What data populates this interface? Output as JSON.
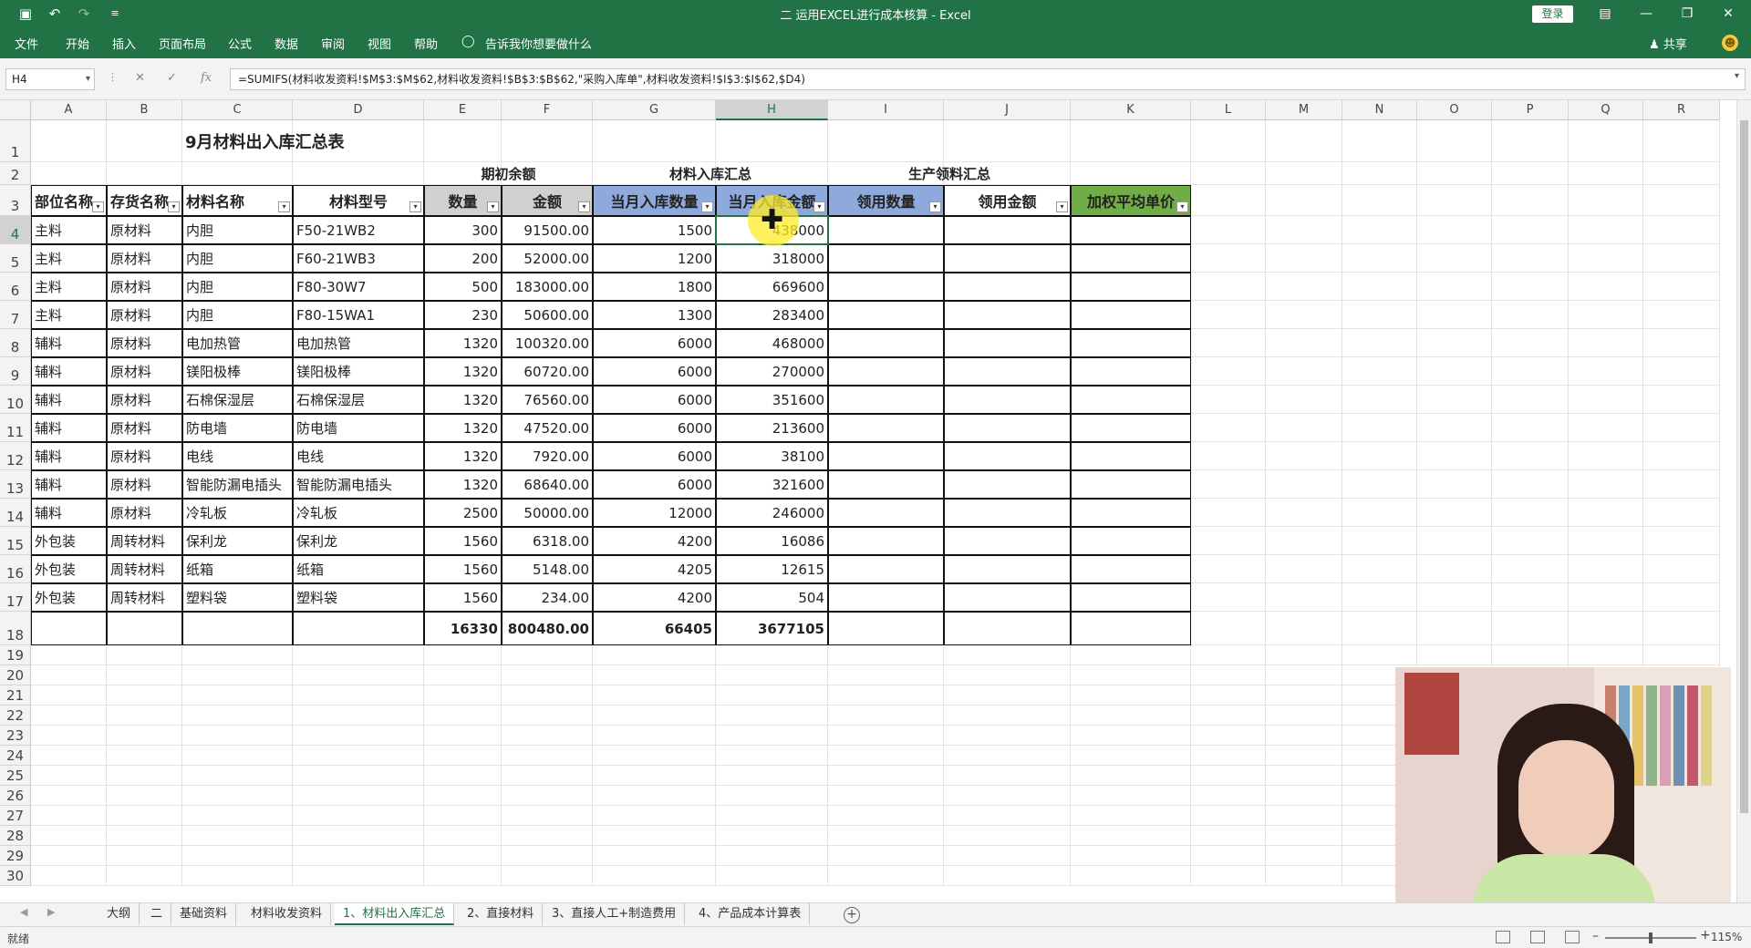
{
  "titlebar": {
    "title": "二 运用EXCEL进行成本核算  -  Excel",
    "login": "登录",
    "save_icon": "save-icon",
    "undo_icon": "undo-icon",
    "redo_icon": "redo-icon"
  },
  "ribbon": {
    "tabs": [
      "文件",
      "开始",
      "插入",
      "页面布局",
      "公式",
      "数据",
      "审阅",
      "视图",
      "帮助"
    ],
    "tellme": "告诉我你想要做什么",
    "share": "共享"
  },
  "formula_bar": {
    "cell_ref": "H4",
    "fx": "fx",
    "formula": "=SUMIFS(材料收发资料!$M$3:$M$62,材料收发资料!$B$3:$B$62,\"采购入库单\",材料收发资料!$I$3:$I$62,$D4)"
  },
  "columns": [
    "A",
    "B",
    "C",
    "D",
    "E",
    "F",
    "G",
    "H",
    "I",
    "J",
    "K",
    "L",
    "M",
    "N",
    "O",
    "P",
    "Q",
    "R"
  ],
  "rows": [
    "1",
    "2",
    "3",
    "4",
    "5",
    "6",
    "7",
    "8",
    "9",
    "10",
    "11",
    "12",
    "13",
    "14",
    "15",
    "16",
    "17",
    "18",
    "19",
    "20",
    "21",
    "22",
    "23",
    "24",
    "25",
    "26",
    "27",
    "28",
    "29",
    "30"
  ],
  "sheet": {
    "title": "9月材料出入库汇总表",
    "group_headers": {
      "opening": "期初余额",
      "inbound": "材料入库汇总",
      "production": "生产领料汇总"
    },
    "headers": [
      "部位名称",
      "存货名称",
      "材料名称",
      "材料型号",
      "数量",
      "金额",
      "当月入库数量",
      "当月入库金额",
      "领用数量",
      "领用金额",
      "加权平均单价"
    ],
    "data": [
      [
        "主料",
        "原材料",
        "内胆",
        "F50-21WB2",
        "300",
        "91500.00",
        "1500",
        "438000"
      ],
      [
        "主料",
        "原材料",
        "内胆",
        "F60-21WB3",
        "200",
        "52000.00",
        "1200",
        "318000"
      ],
      [
        "主料",
        "原材料",
        "内胆",
        "F80-30W7",
        "500",
        "183000.00",
        "1800",
        "669600"
      ],
      [
        "主料",
        "原材料",
        "内胆",
        "F80-15WA1",
        "230",
        "50600.00",
        "1300",
        "283400"
      ],
      [
        "辅料",
        "原材料",
        "电加热管",
        "电加热管",
        "1320",
        "100320.00",
        "6000",
        "468000"
      ],
      [
        "辅料",
        "原材料",
        "镁阳极棒",
        "镁阳极棒",
        "1320",
        "60720.00",
        "6000",
        "270000"
      ],
      [
        "辅料",
        "原材料",
        "石棉保湿层",
        "石棉保湿层",
        "1320",
        "76560.00",
        "6000",
        "351600"
      ],
      [
        "辅料",
        "原材料",
        "防电墙",
        "防电墙",
        "1320",
        "47520.00",
        "6000",
        "213600"
      ],
      [
        "辅料",
        "原材料",
        "电线",
        "电线",
        "1320",
        "7920.00",
        "6000",
        "38100"
      ],
      [
        "辅料",
        "原材料",
        "智能防漏电插头",
        "智能防漏电插头",
        "1320",
        "68640.00",
        "6000",
        "321600"
      ],
      [
        "辅料",
        "原材料",
        "冷轧板",
        "冷轧板",
        "2500",
        "50000.00",
        "12000",
        "246000"
      ],
      [
        "外包装",
        "周转材料",
        "保利龙",
        "保利龙",
        "1560",
        "6318.00",
        "4200",
        "16086"
      ],
      [
        "外包装",
        "周转材料",
        "纸箱",
        "纸箱",
        "1560",
        "5148.00",
        "4205",
        "12615"
      ],
      [
        "外包装",
        "周转材料",
        "塑料袋",
        "塑料袋",
        "1560",
        "234.00",
        "4200",
        "504"
      ]
    ],
    "totals": {
      "qty": "16330",
      "amount": "800480.00",
      "in_qty": "66405",
      "in_amount": "3677105"
    }
  },
  "sheet_tabs": [
    "大纲",
    "二",
    "基础资料",
    "材料收发资料",
    "1、材料出入库汇总",
    "2、直接材料",
    "3、直接人工+制造费用",
    "4、产品成本计算表"
  ],
  "active_sheet": "1、材料出入库汇总",
  "status": {
    "ready": "就绪",
    "zoom": "115%"
  }
}
